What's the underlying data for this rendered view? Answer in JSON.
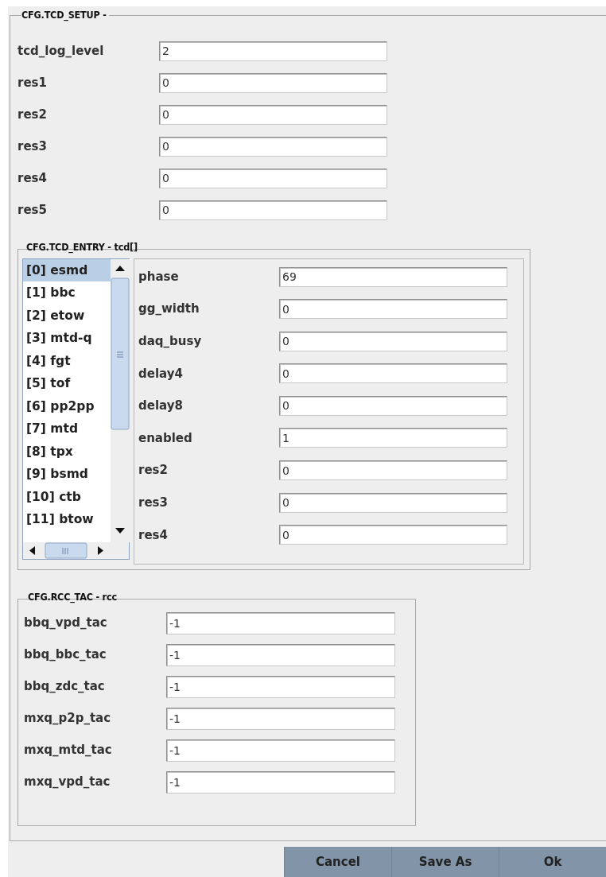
{
  "setup": {
    "title": "CFG.TCD_SETUP -",
    "fields": [
      {
        "label": "tcd_log_level",
        "value": "2"
      },
      {
        "label": "res1",
        "value": "0"
      },
      {
        "label": "res2",
        "value": "0"
      },
      {
        "label": "res3",
        "value": "0"
      },
      {
        "label": "res4",
        "value": "0"
      },
      {
        "label": "res5",
        "value": "0"
      }
    ]
  },
  "entry": {
    "title": "CFG.TCD_ENTRY - tcd[]",
    "list": [
      {
        "label": "[0] esmd",
        "selected": true
      },
      {
        "label": "[1] bbc",
        "selected": false
      },
      {
        "label": "[2] etow",
        "selected": false
      },
      {
        "label": "[3] mtd-q",
        "selected": false
      },
      {
        "label": "[4] fgt",
        "selected": false
      },
      {
        "label": "[5] tof",
        "selected": false
      },
      {
        "label": "[6] pp2pp",
        "selected": false
      },
      {
        "label": "[7] mtd",
        "selected": false
      },
      {
        "label": "[8] tpx",
        "selected": false
      },
      {
        "label": "[9] bsmd",
        "selected": false
      },
      {
        "label": "[10] ctb",
        "selected": false
      },
      {
        "label": "[11] btow",
        "selected": false
      }
    ],
    "fields": [
      {
        "label": "phase",
        "value": "69"
      },
      {
        "label": "gg_width",
        "value": "0"
      },
      {
        "label": "daq_busy",
        "value": "0"
      },
      {
        "label": "delay4",
        "value": "0"
      },
      {
        "label": "delay8",
        "value": "0"
      },
      {
        "label": "enabled",
        "value": "1"
      },
      {
        "label": "res2",
        "value": "0"
      },
      {
        "label": "res3",
        "value": "0"
      },
      {
        "label": "res4",
        "value": "0"
      }
    ]
  },
  "rcc": {
    "title": "CFG.RCC_TAC - rcc",
    "fields": [
      {
        "label": "bbq_vpd_tac",
        "value": "-1"
      },
      {
        "label": "bbq_bbc_tac",
        "value": "-1"
      },
      {
        "label": "bbq_zdc_tac",
        "value": "-1"
      },
      {
        "label": "mxq_p2p_tac",
        "value": "-1"
      },
      {
        "label": "mxq_mtd_tac",
        "value": "-1"
      },
      {
        "label": "mxq_vpd_tac",
        "value": "-1"
      }
    ]
  },
  "buttons": [
    "Cancel",
    "Save As",
    "Ok"
  ]
}
